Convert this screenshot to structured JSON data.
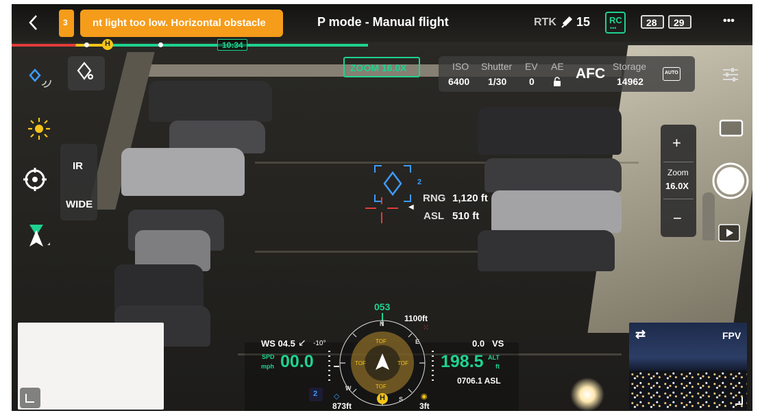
{
  "top_bar": {
    "warning_count": "3",
    "warning_text": "nt light too low. Horizontal obstacle",
    "mode": "P mode - Manual flight",
    "rtk_label": "RTK",
    "satellite_count": "15",
    "rc_label": "RC",
    "aircraft_battery": "28",
    "rc_battery": "29",
    "more_label": "•••"
  },
  "timeline": {
    "home_marker": "H",
    "flight_time": "10:34"
  },
  "zoom_badge": "ZOOM 16.0X",
  "camera": {
    "iso_label": "ISO",
    "iso_value": "6400",
    "shutter_label": "Shutter",
    "shutter_value": "1/30",
    "ev_label": "EV",
    "ev_value": "0",
    "ae_label": "AE",
    "focus_mode": "AFC",
    "storage_label": "Storage",
    "storage_value": "14962",
    "auto_label": "AUTO"
  },
  "left_toolbar": {
    "ir_label": "IR",
    "wide_label": "WIDE"
  },
  "target": {
    "id": "2",
    "rng_label": "RNG",
    "rng_value": "1,120 ft",
    "asl_label": "ASL",
    "asl_value": "510 ft"
  },
  "zoom_control": {
    "plus": "+",
    "label": "Zoom",
    "value": "16.0X",
    "minus": "−"
  },
  "fpv": {
    "label": "FPV",
    "swap_icon": "⇄"
  },
  "hud": {
    "heading": "053",
    "obstacle_dist": "1100ft",
    "wind": "WS 04.5",
    "wind_angle": "-10°",
    "speed_label_1": "SPD",
    "speed_label_2": "mph",
    "speed": "00.0",
    "vs_value": "0.0",
    "vs_label": "VS",
    "altitude": "198.5",
    "alt_label_1": "ALT",
    "alt_label_2": "ft",
    "asl_alt": "0706.1 ASL",
    "home_dist": "873ft",
    "bottom_dist": "3ft",
    "marker_id": "2",
    "tof_top": "TOF",
    "tof_left": "TOF",
    "tof_right": "TOF",
    "tof_bottom": "TOF",
    "compass_n": "N",
    "compass_e": "E",
    "compass_s": "S",
    "compass_w": "W",
    "home_marker": "H"
  }
}
